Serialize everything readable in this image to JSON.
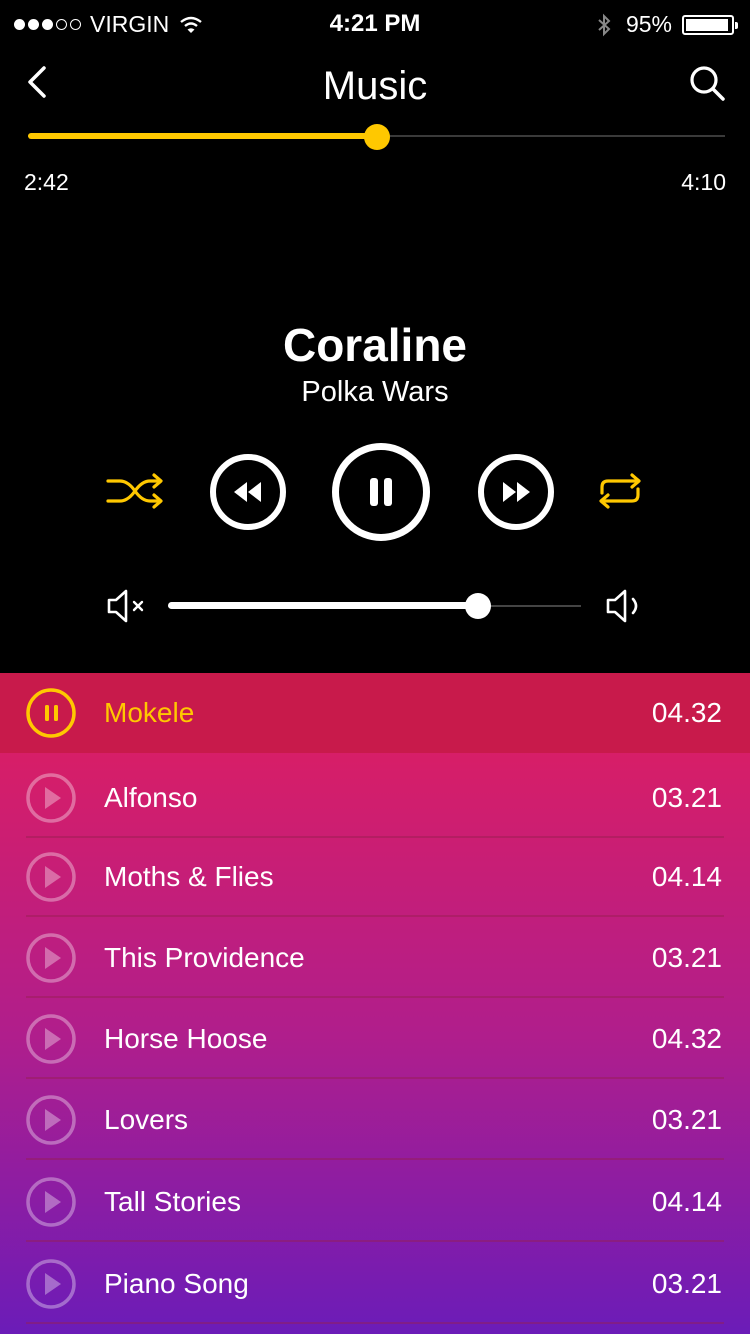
{
  "status_bar": {
    "carrier": "VIRGIN",
    "time": "4:21 PM",
    "battery": "95%",
    "battery_level": 0.95,
    "signal_bars_filled": 3,
    "signal_bars_total": 5
  },
  "nav": {
    "title": "Music",
    "back_icon": "chevron-left-icon",
    "search_icon": "search-icon"
  },
  "progress": {
    "elapsed": "2:42",
    "total": "4:10",
    "fraction": 0.5
  },
  "now_playing": {
    "title": "Coraline",
    "artist": "Polka Wars"
  },
  "controls": {
    "shuffle_icon": "shuffle-icon",
    "rewind_icon": "rewind-icon",
    "pause_icon": "pause-icon",
    "fast_forward_icon": "fast-forward-icon",
    "repeat_icon": "repeat-icon"
  },
  "volume": {
    "level": 0.75,
    "mute_icon": "volume-mute-icon",
    "max_icon": "volume-up-icon"
  },
  "colors": {
    "accent": "#FFC800",
    "active_row": "#C81A4B",
    "playlist_top": "#E21E5D",
    "playlist_bottom": "#6B1CB8"
  },
  "playlist": [
    {
      "title": "Mokele",
      "duration": "04.32",
      "playing": true
    },
    {
      "title": "Alfonso",
      "duration": "03.21",
      "playing": false
    },
    {
      "title": "Moths & Flies",
      "duration": "04.14",
      "playing": false
    },
    {
      "title": "This Providence",
      "duration": "03.21",
      "playing": false
    },
    {
      "title": "Horse Hoose",
      "duration": "04.32",
      "playing": false
    },
    {
      "title": "Lovers",
      "duration": "03.21",
      "playing": false
    },
    {
      "title": "Tall Stories",
      "duration": "04.14",
      "playing": false
    },
    {
      "title": "Piano Song",
      "duration": "03.21",
      "playing": false
    }
  ]
}
